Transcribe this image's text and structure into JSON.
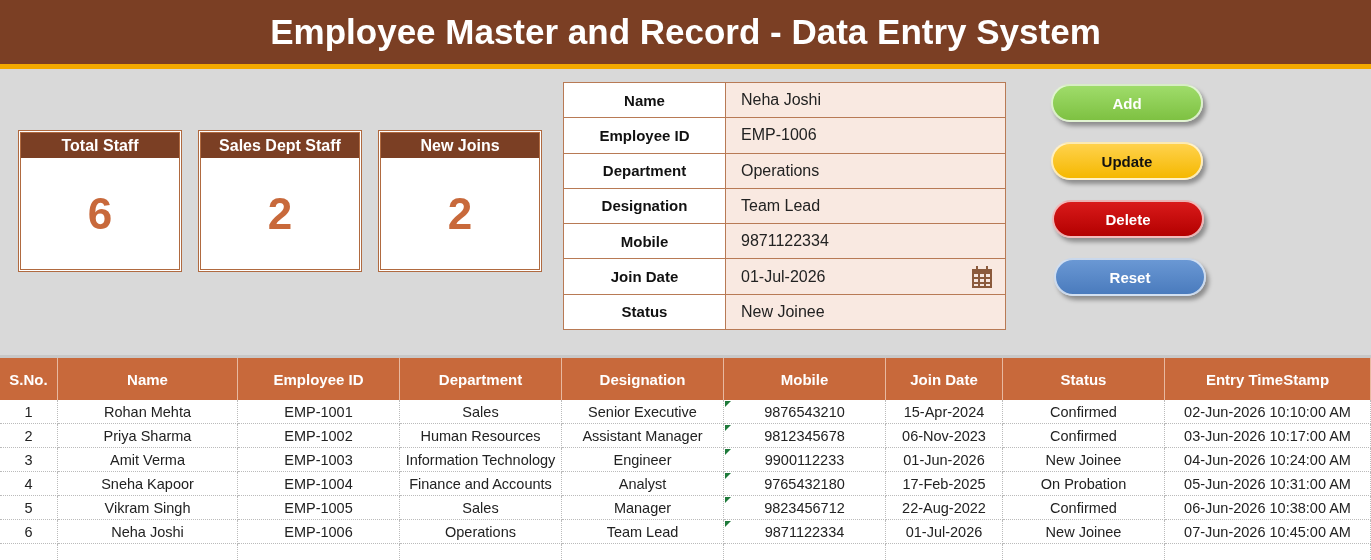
{
  "title": "Employee Master and Record - Data Entry System",
  "kpis": [
    {
      "label": "Total Staff",
      "value": "6"
    },
    {
      "label": "Sales Dept Staff",
      "value": "2"
    },
    {
      "label": "New Joins",
      "value": "2"
    }
  ],
  "form": [
    {
      "label": "Name",
      "value": "Neha Joshi",
      "kind": "text"
    },
    {
      "label": "Employee ID",
      "value": "EMP-1006",
      "kind": "text"
    },
    {
      "label": "Department",
      "value": "Operations",
      "kind": "text"
    },
    {
      "label": "Designation",
      "value": "Team Lead",
      "kind": "text"
    },
    {
      "label": "Mobile",
      "value": "9871122334",
      "kind": "text"
    },
    {
      "label": "Join Date",
      "value": "01-Jul-2026",
      "kind": "date"
    },
    {
      "label": "Status",
      "value": "New Joinee",
      "kind": "text"
    }
  ],
  "buttons": [
    {
      "label": "Add",
      "kind": "add"
    },
    {
      "label": "Update",
      "kind": "update"
    },
    {
      "label": "Delete",
      "kind": "delete"
    },
    {
      "label": "Reset",
      "kind": "reset"
    }
  ],
  "table": {
    "columns": [
      "S.No.",
      "Name",
      "Employee ID",
      "Department",
      "Designation",
      "Mobile",
      "Join Date",
      "Status",
      "Entry TimeStamp"
    ],
    "rows": [
      [
        "1",
        "Rohan Mehta",
        "EMP-1001",
        "Sales",
        "Senior Executive",
        "9876543210",
        "15-Apr-2024",
        "Confirmed",
        "02-Jun-2026 10:10:00 AM"
      ],
      [
        "2",
        "Priya Sharma",
        "EMP-1002",
        "Human Resources",
        "Assistant Manager",
        "9812345678",
        "06-Nov-2023",
        "Confirmed",
        "03-Jun-2026 10:17:00 AM"
      ],
      [
        "3",
        "Amit Verma",
        "EMP-1003",
        "Information Technology",
        "Engineer",
        "9900112233",
        "01-Jun-2026",
        "New Joinee",
        "04-Jun-2026 10:24:00 AM"
      ],
      [
        "4",
        "Sneha Kapoor",
        "EMP-1004",
        "Finance and Accounts",
        "Analyst",
        "9765432180",
        "17-Feb-2025",
        "On Probation",
        "05-Jun-2026 10:31:00 AM"
      ],
      [
        "5",
        "Vikram Singh",
        "EMP-1005",
        "Sales",
        "Manager",
        "9823456712",
        "22-Aug-2022",
        "Confirmed",
        "06-Jun-2026 10:38:00 AM"
      ],
      [
        "6",
        "Neha Joshi",
        "EMP-1006",
        "Operations",
        "Team Lead",
        "9871122334",
        "01-Jul-2026",
        "New Joinee",
        "07-Jun-2026 10:45:00 AM"
      ]
    ]
  }
}
